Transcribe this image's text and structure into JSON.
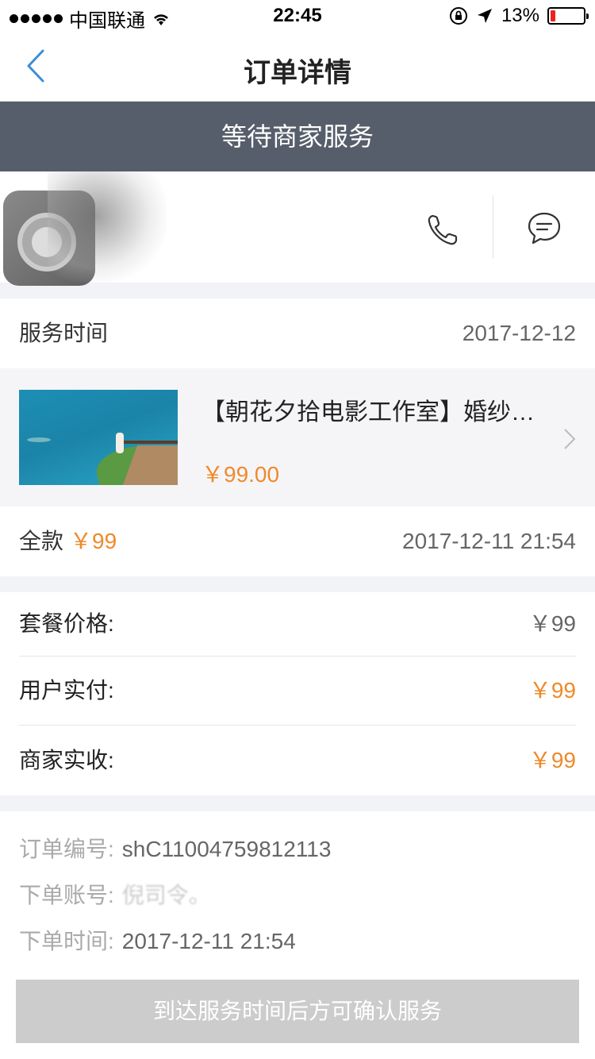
{
  "status_bar": {
    "carrier": "中国联通",
    "time": "22:45",
    "battery_percent": "13%"
  },
  "nav": {
    "title": "订单详情"
  },
  "status_banner": {
    "text": "等待商家服务"
  },
  "service_time": {
    "label": "服务时间",
    "value": "2017-12-12"
  },
  "product": {
    "title": "【朝花夕拾电影工作室】婚纱…",
    "price": "￥99.00"
  },
  "payment": {
    "label": "全款",
    "amount": "￥99",
    "datetime": "2017-12-11 21:54"
  },
  "price_summary": {
    "package_price_label": "套餐价格:",
    "package_price_value": "￥99",
    "user_paid_label": "用户实付:",
    "user_paid_value": "￥99",
    "merchant_received_label": "商家实收:",
    "merchant_received_value": "￥99"
  },
  "order_info": {
    "order_no_label": "订单编号:",
    "order_no_value": "shC11004759812113",
    "account_label": "下单账号:",
    "account_value": "倪司令。",
    "order_time_label": "下单时间:",
    "order_time_value": "2017-12-11 21:54"
  },
  "confirm_button": {
    "label": "到达服务时间后方可确认服务"
  },
  "colors": {
    "accent_orange": "#ee8a2a",
    "banner_bg": "#575e6b",
    "nav_back_blue": "#3b8ed8",
    "disabled_button": "#cccccc"
  },
  "icons": {
    "back": "chevron-left-icon",
    "phone": "phone-icon",
    "chat": "chat-bubble-icon",
    "product_chevron": "chevron-right-icon"
  }
}
